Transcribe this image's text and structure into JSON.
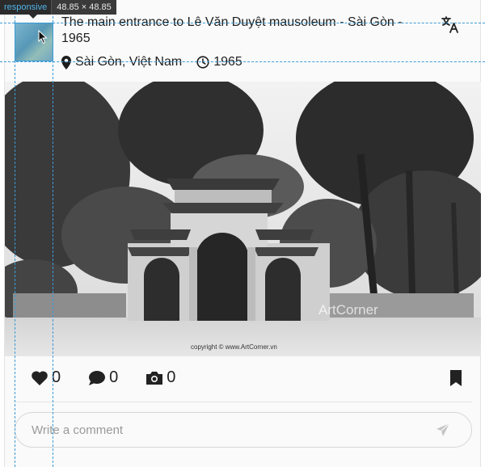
{
  "devtools": {
    "element_tag": "responsive",
    "element_dims": "48.85 × 48.85"
  },
  "post": {
    "title": "The main entrance to Lê Văn Duyệt mausoleum - Sài Gòn - 1965",
    "location": "Sài Gòn, Việt Nam",
    "year": "1965",
    "photo_watermark": "copyright © www.ArtCorner.vn",
    "photo_overlay_text": "ArtCorner"
  },
  "actions": {
    "likes": "0",
    "comments": "0",
    "photos": "0"
  },
  "comment_box": {
    "placeholder": "Write a comment"
  },
  "icons": {
    "translate": "translate-icon",
    "location": "map-pin-icon",
    "clock": "clock-icon",
    "like": "heart-icon",
    "comment": "speech-bubble-icon",
    "photo": "camera-icon",
    "bookmark": "bookmark-icon",
    "send": "paper-plane-icon"
  },
  "colors": {
    "guide": "#3a9bd8",
    "devtip_bg": "#2b2b2b",
    "devtip_tag": "#4fb4e8"
  }
}
